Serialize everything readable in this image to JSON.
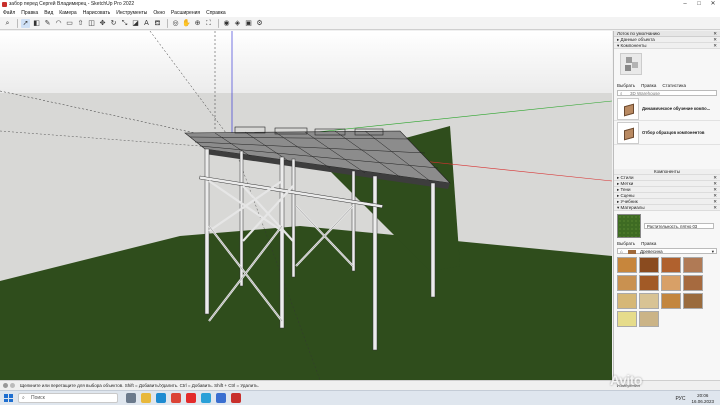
{
  "window": {
    "title": "забор перед Сергей Владимирец - SketchUp Pro 2022",
    "controls": [
      "–",
      "□",
      "✕"
    ]
  },
  "menu": [
    "Файл",
    "Правка",
    "Вид",
    "Камера",
    "Нарисовать",
    "Инструменты",
    "Окно",
    "Расширения",
    "Справка"
  ],
  "tray": {
    "header": "Лоток по умолчанию",
    "entity_info": "Данные объекта",
    "components": "Компоненты",
    "tabs": [
      "Выбрать",
      "Правка",
      "Статистика"
    ],
    "search_placeholder": "3D Warehouse",
    "component_items": [
      {
        "name": "Динамическое обучение компо..."
      },
      {
        "name": "Отбор образцов компонентов"
      }
    ],
    "components_footer": "Компоненты",
    "sections": [
      "Стили",
      "Метки",
      "Тени",
      "Сцены",
      "Учебник"
    ],
    "materials": "Материалы",
    "material_name": "Растительность, пятно 03",
    "mat_tabs": [
      "Выбрать",
      "Правка"
    ],
    "mat_collection": "Древесина",
    "swatch_colors": [
      "#c7863c",
      "#8a4b1f",
      "#b0612e",
      "#b07a55",
      "#c99150",
      "#a25a26",
      "#d8a067",
      "#a66a3f",
      "#d6b776",
      "#d8c394",
      "#c3863e",
      "#9a6b3d",
      "#e6dc8b",
      "#cbb487"
    ]
  },
  "status": {
    "text": "Щелкните или перетащите для выбора объектов. Shift = Добавить/Удалить. Ctrl = Добавить. Shift + Ctrl = Удалить.",
    "measure": "Измерения"
  },
  "taskbar": {
    "search": "Поиск",
    "lang": "РУС",
    "time": "20:06",
    "date": "16.06.2023"
  },
  "watermark": "Avito",
  "colors": {
    "ground": "#2e4a1c",
    "sky_gradient_top": "#ffffff",
    "horizon": "#d9d9d9",
    "frame": "#e8e8e8",
    "roof": "#5a5a5a"
  }
}
